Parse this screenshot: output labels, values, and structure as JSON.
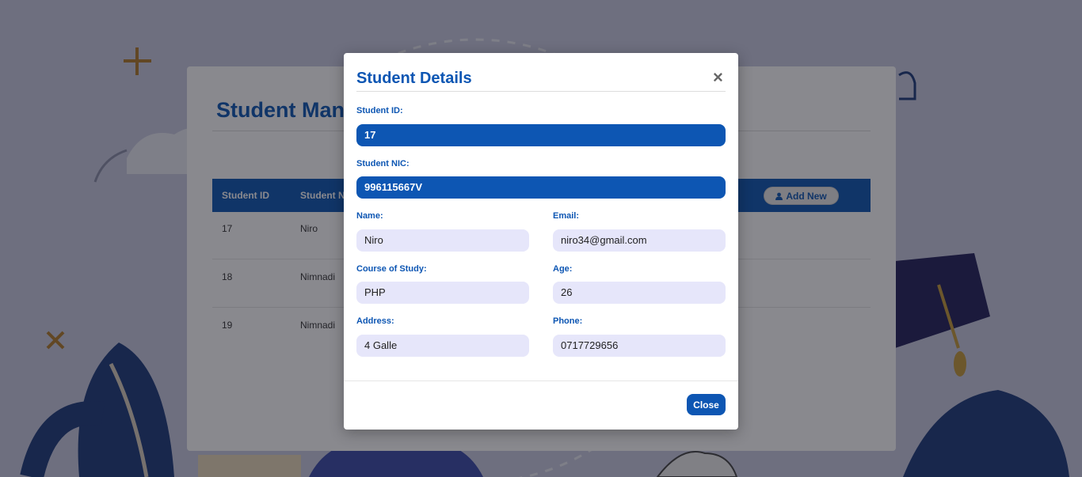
{
  "page": {
    "title": "Student Management",
    "table": {
      "headers": [
        "Student ID",
        "Student Name"
      ],
      "add_label": "Add New",
      "rows": [
        {
          "id": "17",
          "name": "Niro"
        },
        {
          "id": "18",
          "name": "Nimnadi"
        },
        {
          "id": "19",
          "name": "Nimnadi"
        }
      ]
    }
  },
  "modal": {
    "title": "Student Details",
    "close_symbol": "×",
    "fields": {
      "student_id_label": "Student ID:",
      "student_id": "17",
      "student_nic_label": "Student NIC:",
      "student_nic": "996115667V",
      "name_label": "Name:",
      "name": "Niro",
      "email_label": "Email:",
      "email": "niro34@gmail.com",
      "course_label": "Course of Study:",
      "course": "PHP",
      "age_label": "Age:",
      "age": "26",
      "address_label": "Address:",
      "address": "4 Galle",
      "phone_label": "Phone:",
      "phone": "0717729656"
    },
    "close_label": "Close"
  },
  "colors": {
    "accent": "#0d56b3",
    "field_bg": "#e6e6fa",
    "overlay": "#2b2b3a"
  },
  "icons": [
    "user-icon",
    "close-icon"
  ]
}
